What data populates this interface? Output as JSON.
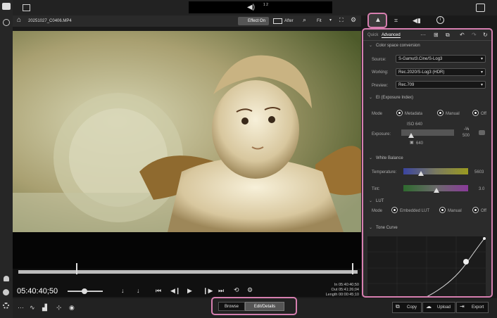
{
  "topbar": {
    "volume_value": "1  2"
  },
  "file": {
    "name": "20251027_C0406.MP4"
  },
  "player_toolbar": {
    "effect_label": "Effect On",
    "after_label": "After",
    "fit_label": "Fit"
  },
  "playback": {
    "timecode": "05:40:40;50",
    "in_label": "In",
    "in_value": "05:40:40;50",
    "out_label": "Out",
    "out_value": "05:41:26;04",
    "length_label": "Length",
    "length_value": "00:00:45;10"
  },
  "bottom": {
    "browse_label": "Browse",
    "edit_label": "Edit/Details",
    "copy_label": "Copy",
    "upload_label": "Upload",
    "export_label": "Export"
  },
  "panel": {
    "tab_quick": "Quick",
    "tab_advanced": "Advanced",
    "color_space": {
      "title": "Color space conversion",
      "source_label": "Source:",
      "source_value": "S-Gamut3.Cine/S-Log3",
      "working_label": "Working:",
      "working_value": "Rec.2020/S-Log3 (HDR)",
      "preview_label": "Preview:",
      "preview_value": "Rec.709"
    },
    "ei": {
      "title": "EI (Exposure Index)",
      "mode_label": "Mode",
      "opt_metadata": "Metadata",
      "opt_manual": "Manual",
      "opt_off": "Off",
      "iso": "ISO 640",
      "exposure_label": "Exposure:",
      "exposure_value": "-⅓",
      "exposure_sub": "500",
      "iso_bottom": "640"
    },
    "wb": {
      "title": "White Balance",
      "temperature_label": "Temperature:",
      "temperature_value": "5603",
      "tint_label": "Tint:",
      "tint_value": "3.0"
    },
    "lut": {
      "title": "LUT",
      "mode_label": "Mode",
      "opt_embedded": "Embedded LUT",
      "opt_manual": "Manual",
      "opt_off": "Off"
    },
    "tone_curve": {
      "title": "Tone Curve"
    }
  },
  "colors": {
    "accent_highlight": "#d77fb0"
  }
}
